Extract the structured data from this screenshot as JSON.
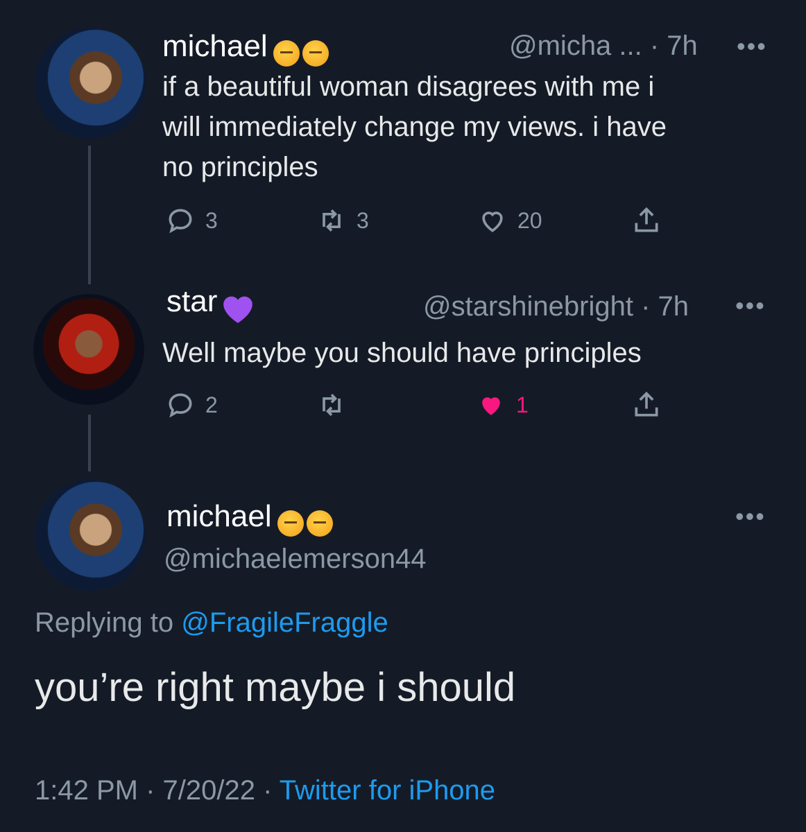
{
  "tweet1": {
    "name": "michael",
    "handle": "@micha ... · 7h",
    "more": "•••",
    "text_lines": [
      "if a beautiful woman disagrees with me i",
      "will immediately change my views. i have",
      "no principles"
    ],
    "replies": "3",
    "retweets": "3",
    "likes": "20"
  },
  "tweet2": {
    "name": "star",
    "handle": "@starshinebright · 7h",
    "more": "•••",
    "text": "Well maybe you should have principles",
    "replies": "2",
    "retweets": "",
    "likes": "1",
    "like_color": "#f91880"
  },
  "main": {
    "name": "michael",
    "handle": "@michaelemerson44",
    "more": "•••",
    "replying_prefix": "Replying to",
    "replying_to": "@FragileFraggle",
    "text": "you’re right maybe i should",
    "timestamp": "1:42 PM · 7/20/22 ·",
    "source": "Twitter for iPhone",
    "link_color": "#1d9bf0"
  },
  "colors": {
    "background": "#151b26",
    "muted": "#8b98a5",
    "text": "#e7e9ea"
  }
}
